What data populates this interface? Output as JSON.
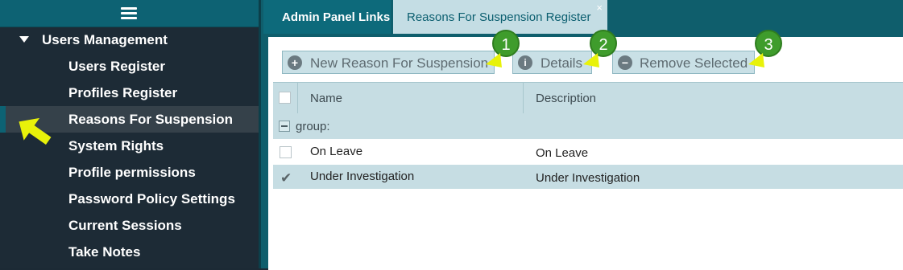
{
  "sidebar": {
    "group_label": "Users Management",
    "items": [
      {
        "label": "Users Register"
      },
      {
        "label": "Profiles Register"
      },
      {
        "label": "Reasons For Suspension"
      },
      {
        "label": "System Rights"
      },
      {
        "label": "Profile permissions"
      },
      {
        "label": "Password Policy Settings"
      },
      {
        "label": "Current Sessions"
      },
      {
        "label": "Take Notes"
      }
    ],
    "active_index": 2
  },
  "tabs": [
    {
      "label": "Admin Panel Links"
    },
    {
      "label": "Reasons For Suspension Register",
      "close": "×"
    }
  ],
  "toolbar": {
    "new_label": "New Reason For Suspension",
    "details_label": "Details",
    "remove_label": "Remove Selected"
  },
  "callouts": [
    "1",
    "2",
    "3"
  ],
  "grid": {
    "columns": [
      "Name",
      "Description"
    ],
    "group_label": "group:",
    "rows": [
      {
        "name": "On Leave",
        "description": "On Leave",
        "checked": false
      },
      {
        "name": "Under Investigation",
        "description": "Under Investigation",
        "checked": true
      }
    ]
  },
  "colors": {
    "accent": "#0d6273",
    "callout_green": "#3f9c2c",
    "pointer_yellow": "#e8f20a"
  }
}
